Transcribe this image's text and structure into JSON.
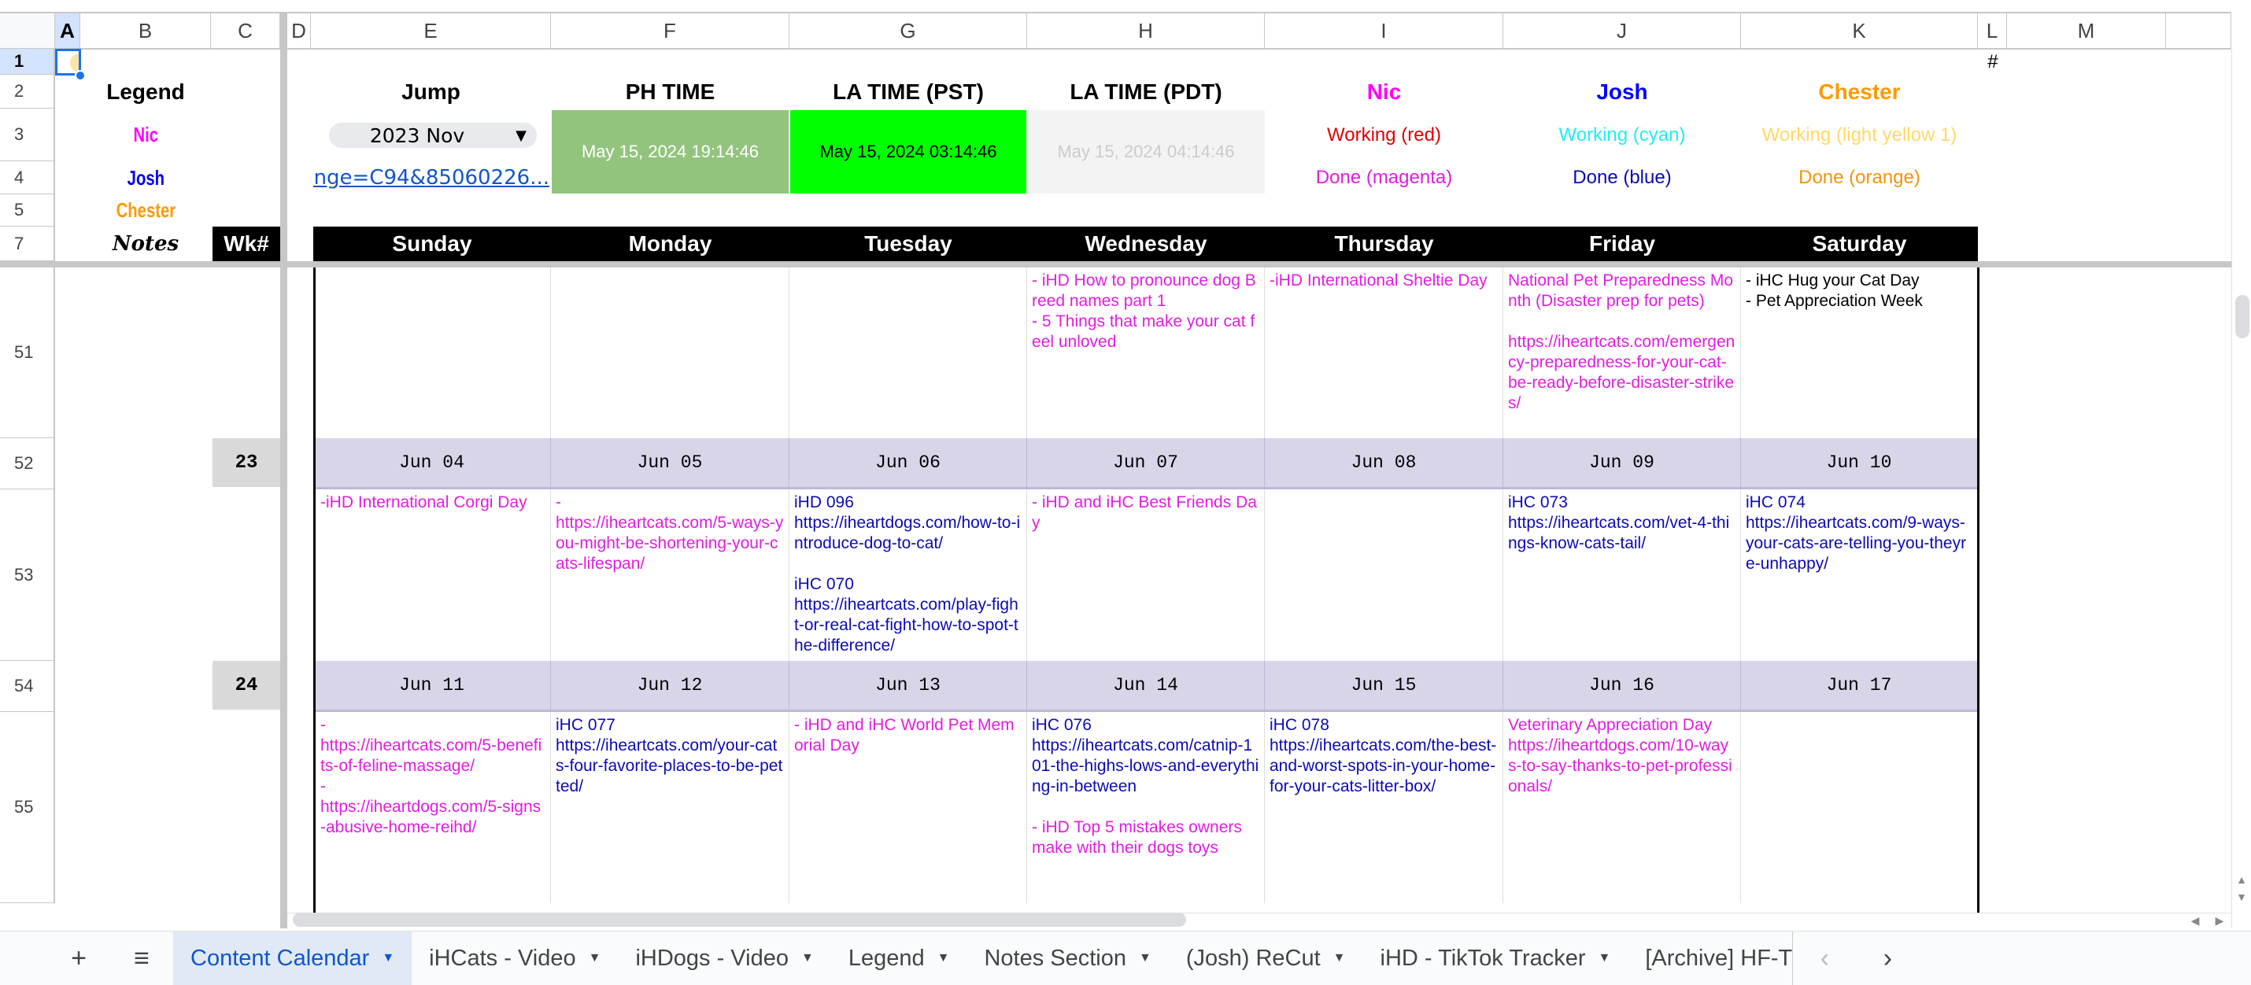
{
  "columns": [
    "A",
    "B",
    "C",
    "D",
    "E",
    "F",
    "G",
    "H",
    "I",
    "J",
    "K",
    "L",
    "M",
    ""
  ],
  "selected_column": "A",
  "rows_frozen": [
    "1",
    "2",
    "3",
    "4",
    "5",
    "7"
  ],
  "rows_body": [
    "51",
    "52",
    "53",
    "54",
    "55"
  ],
  "selected_row": "1",
  "l1_marker": "#",
  "legend": {
    "title": "Legend",
    "nic": "Nic",
    "josh": "Josh",
    "chester": "Chester",
    "notes": "Notes",
    "wk_header": "Wk#"
  },
  "jump": {
    "title": "Jump",
    "dropdown_value": "2023 Nov",
    "link_text": "...85060226&range=C94"
  },
  "times": {
    "ph_label": "PH TIME",
    "ph_value": "May 15, 2024  19:14:46",
    "pst_label": "LA TIME (PST)",
    "pst_value": "May 15, 2024  03:14:46",
    "pdt_label": "LA TIME (PDT)",
    "pdt_value": "May 15, 2024  04:14:46"
  },
  "status_legend": {
    "nic": {
      "name": "Nic",
      "working": "Working (red)",
      "done": "Done (magenta)"
    },
    "josh": {
      "name": "Josh",
      "working": "Working (cyan)",
      "done": "Done (blue)"
    },
    "chester": {
      "name": "Chester",
      "working": "Working (light yellow 1)",
      "done": "Done (orange)"
    }
  },
  "colors": {
    "nic": "#ff00ff",
    "josh": "#0000ff",
    "chester": "#ff9900",
    "working_red": "#e00000",
    "working_cyan": "#22eeee",
    "working_yellow": "#ffd966",
    "done_magenta": "#e11de1",
    "done_blue": "#0b0bb5",
    "done_orange": "#f0950c",
    "ph_bg": "#93c47d",
    "pst_bg": "#00ff00",
    "pdt_bg": "#f3f3f3",
    "date_row_bg": "#d9d5e9"
  },
  "days": [
    "Sunday",
    "Monday",
    "Tuesday",
    "Wednesday",
    "Thursday",
    "Friday",
    "Saturday"
  ],
  "weeks": [
    {
      "row": "51",
      "cells": [
        [],
        [],
        [],
        [
          {
            "c": "mag",
            "t": "- iHD How to pronounce dog Breed names part 1\n- 5 Things that make your cat feel unloved"
          }
        ],
        [
          {
            "c": "mag",
            "t": "-iHD International Sheltie Day"
          }
        ],
        [
          {
            "c": "mag",
            "t": "National Pet Preparedness Month (Disaster prep for pets)\n\nhttps://iheartcats.com/emergency-preparedness-for-your-cat-be-ready-before-disaster-strikes/"
          }
        ],
        [
          {
            "c": "blk",
            "t": "- iHC Hug your Cat Day\n- Pet Appreciation Week"
          }
        ]
      ]
    },
    {
      "week_number": "23",
      "dates": [
        "Jun 04",
        "Jun 05",
        "Jun 06",
        "Jun 07",
        "Jun 08",
        "Jun 09",
        "Jun 10"
      ],
      "cells": [
        [
          {
            "c": "mag",
            "t": "-iHD International Corgi Day"
          }
        ],
        [
          {
            "c": "mag",
            "t": "-\nhttps://iheartcats.com/5-ways-you-might-be-shortening-your-cats-lifespan/"
          }
        ],
        [
          {
            "c": "blu",
            "t": "iHD 096\nhttps://iheartdogs.com/how-to-introduce-dog-to-cat/\n\niHC 070\nhttps://iheartcats.com/play-fight-or-real-cat-fight-how-to-spot-the-difference/"
          }
        ],
        [
          {
            "c": "mag",
            "t": "- iHD and iHC Best Friends Day"
          }
        ],
        [],
        [
          {
            "c": "blu",
            "t": "iHC 073\nhttps://iheartcats.com/vet-4-things-know-cats-tail/"
          }
        ],
        [
          {
            "c": "blu",
            "t": "iHC 074\nhttps://iheartcats.com/9-ways-your-cats-are-telling-you-theyre-unhappy/"
          }
        ]
      ]
    },
    {
      "week_number": "24",
      "dates": [
        "Jun 11",
        "Jun 12",
        "Jun 13",
        "Jun 14",
        "Jun 15",
        "Jun 16",
        "Jun 17"
      ],
      "cells": [
        [
          {
            "c": "mag",
            "t": "-\nhttps://iheartcats.com/5-benefits-of-feline-massage/\n-\nhttps://iheartdogs.com/5-signs-abusive-home-reihd/"
          }
        ],
        [
          {
            "c": "blu",
            "t": "iHC 077\nhttps://iheartcats.com/your-cats-four-favorite-places-to-be-petted/"
          }
        ],
        [
          {
            "c": "mag",
            "t": "- iHD and iHC World Pet Memorial Day"
          }
        ],
        [
          {
            "c": "blu",
            "t": "iHC 076\nhttps://iheartcats.com/catnip-101-the-highs-lows-and-everything-in-between\n\n"
          },
          {
            "c": "mag",
            "t": "- iHD Top 5 mistakes owners make with their dogs toys"
          }
        ],
        [
          {
            "c": "blu",
            "t": "iHC 078\nhttps://iheartcats.com/the-best-and-worst-spots-in-your-home-for-your-cats-litter-box/"
          }
        ],
        [
          {
            "c": "mag",
            "t": "Veterinary Appreciation Day\nhttps://iheartdogs.com/10-ways-to-say-thanks-to-pet-professionals/"
          }
        ],
        []
      ]
    }
  ],
  "sheet_tabs": {
    "add_label": "+",
    "menu_label": "≡",
    "tabs": [
      {
        "label": "Content Calendar",
        "active": true
      },
      {
        "label": "iHCats - Video",
        "active": false
      },
      {
        "label": "iHDogs - Video",
        "active": false
      },
      {
        "label": "Legend",
        "active": false
      },
      {
        "label": "Notes Section",
        "active": false
      },
      {
        "label": "(Josh) ReCut",
        "active": false
      },
      {
        "label": "iHD - TikTok Tracker",
        "active": false
      },
      {
        "label": "[Archive] HF-T",
        "active": false
      }
    ],
    "prev_label": "‹",
    "next_label": "›"
  }
}
